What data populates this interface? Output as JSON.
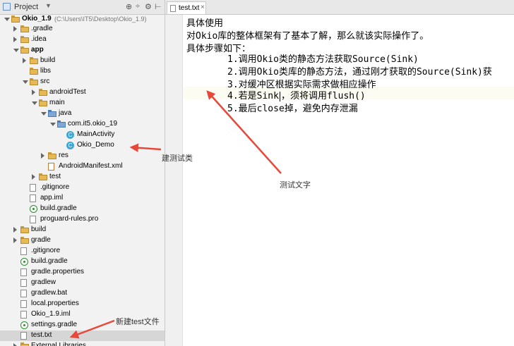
{
  "project_panel": {
    "title": "Project",
    "icons": [
      "settings-icon",
      "sync-icon",
      "gear-icon",
      "hide-icon"
    ],
    "tree": [
      {
        "label": "Okio_1.9",
        "path": "(C:\\Users\\IT5\\Desktop\\Okio_1.9)",
        "icon": "module-folder",
        "state": "expanded",
        "bold": true
      },
      {
        "label": ".gradle",
        "icon": "folder",
        "state": "collapsed"
      },
      {
        "label": ".idea",
        "icon": "folder",
        "state": "collapsed"
      },
      {
        "label": "app",
        "icon": "module-folder",
        "state": "expanded",
        "bold": true
      },
      {
        "label": "build",
        "icon": "folder",
        "state": "collapsed"
      },
      {
        "label": "libs",
        "icon": "folder",
        "state": "none"
      },
      {
        "label": "src",
        "icon": "folder",
        "state": "expanded"
      },
      {
        "label": "androidTest",
        "icon": "folder",
        "state": "collapsed"
      },
      {
        "label": "main",
        "icon": "folder",
        "state": "expanded"
      },
      {
        "label": "java",
        "icon": "source-folder",
        "state": "expanded"
      },
      {
        "label": "com.it5.okio_19",
        "icon": "package",
        "state": "expanded"
      },
      {
        "label": "MainActivity",
        "icon": "class",
        "state": "none"
      },
      {
        "label": "Okio_Demo",
        "icon": "class",
        "state": "none"
      },
      {
        "label": "res",
        "icon": "folder",
        "state": "collapsed"
      },
      {
        "label": "AndroidManifest.xml",
        "icon": "xml-file",
        "state": "none"
      },
      {
        "label": "test",
        "icon": "folder",
        "state": "collapsed"
      },
      {
        "label": ".gitignore",
        "icon": "file",
        "state": "none"
      },
      {
        "label": "app.iml",
        "icon": "file",
        "state": "none"
      },
      {
        "label": "build.gradle",
        "icon": "gradle-file",
        "state": "none"
      },
      {
        "label": "proguard-rules.pro",
        "icon": "file",
        "state": "none"
      },
      {
        "label": "build",
        "icon": "folder",
        "state": "collapsed"
      },
      {
        "label": "gradle",
        "icon": "folder",
        "state": "collapsed"
      },
      {
        "label": ".gitignore",
        "icon": "file",
        "state": "none"
      },
      {
        "label": "build.gradle",
        "icon": "gradle-file",
        "state": "none"
      },
      {
        "label": "gradle.properties",
        "icon": "file",
        "state": "none"
      },
      {
        "label": "gradlew",
        "icon": "file",
        "state": "none"
      },
      {
        "label": "gradlew.bat",
        "icon": "file",
        "state": "none"
      },
      {
        "label": "local.properties",
        "icon": "file",
        "state": "none"
      },
      {
        "label": "Okio_1.9.iml",
        "icon": "file",
        "state": "none"
      },
      {
        "label": "settings.gradle",
        "icon": "gradle-file",
        "state": "none"
      },
      {
        "label": "test.txt",
        "icon": "file",
        "state": "none",
        "selected": true
      },
      {
        "label": "External Libraries",
        "icon": "library",
        "state": "collapsed"
      }
    ]
  },
  "editor": {
    "tab_label": "test.txt",
    "tab_close": "×",
    "lines": [
      "具体使用",
      "对Okio库的整体框架有了基本了解，那么就该实际操作了。",
      "具体步骤如下：",
      "1.调用Okio类的静态方法获取Source(Sink)",
      "2.调用Okio类库的静态方法，通过刚才获取的Source(Sink)获",
      "3.对缓冲区根据实际需求做相应操作",
      "4.若是Sink",
      "，须将调用flush()",
      "5.最后close掉，避免内存泄漏"
    ]
  },
  "annotations": {
    "create_test_class": "建测试类",
    "test_text": "测试文字",
    "new_test_file": "新建test文件"
  },
  "colors": {
    "arrow": "#e8473a",
    "folder": "#e6b955",
    "source_folder": "#7fa7d6",
    "class_icon": "#3fa6d3",
    "selection": "#d6d6d6"
  }
}
